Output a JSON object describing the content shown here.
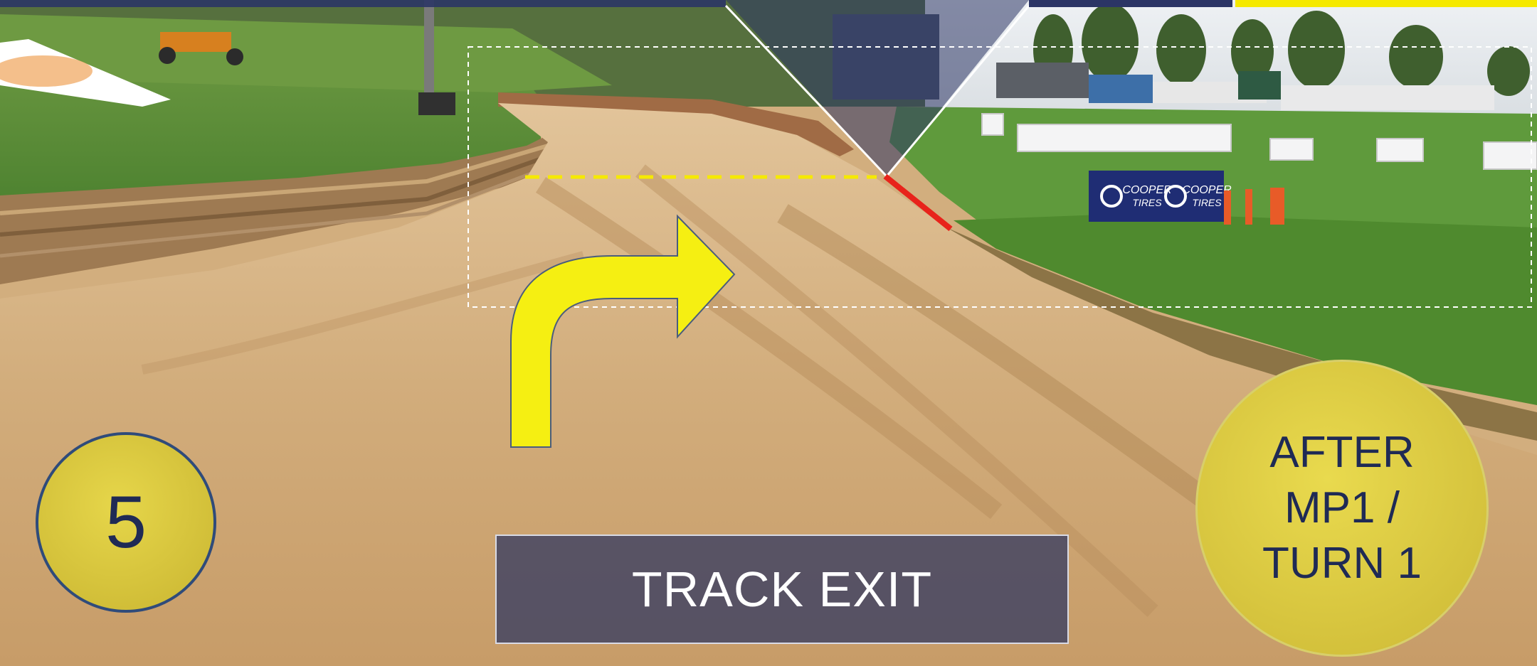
{
  "step_badge": {
    "number": "5"
  },
  "timing_badge": {
    "lines": [
      "AFTER",
      "MP1 /",
      "TURN 1"
    ]
  },
  "caption": {
    "label": "TRACK EXIT"
  },
  "colors": {
    "accent_yellow": "#f5e900",
    "marker_red": "#e8231b",
    "navy": "#1f2a55",
    "caption_bg": "#373c62"
  },
  "sign": {
    "text": [
      "COOPER TIRES",
      "COOPER TIRES"
    ]
  }
}
